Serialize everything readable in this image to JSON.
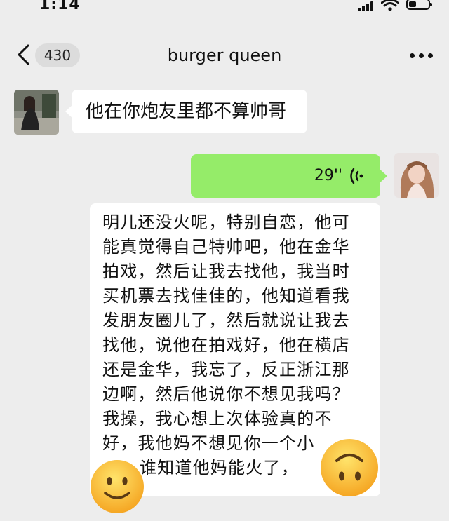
{
  "status_bar": {
    "time": "1:14"
  },
  "nav": {
    "back_icon": "chevron-left-icon",
    "unread_count": "430",
    "title": "burger queen",
    "more_icon": "more-dots-icon"
  },
  "messages": [
    {
      "side": "left",
      "type": "text",
      "text": "他在你炮友里都不算帅哥"
    },
    {
      "side": "right",
      "type": "voice",
      "duration": "29''",
      "icon": "voice-wave-icon"
    },
    {
      "side": "left",
      "type": "text",
      "text": "明儿还没火呢，特别自恋，他可\n能真觉得自己特帅吧，他在金华\n拍戏，然后让我去找他，我当时\n买机票去找佳佳的，他知道看我\n发朋友圈儿了，然后就说让我去\n找他，说他在拍戏好，他在横店\n还是金华，我忘了，反正浙江那\n边啊，然后他说你不想见我吗？\n我操，我心想上次体验真的不\n好，我他妈不想见你一个小\n      谁知道他妈能火了，"
    }
  ],
  "overlays": [
    "smiling-face-emoji",
    "upside-down-face-emoji"
  ],
  "colors": {
    "background": "#ededed",
    "sent_bubble": "#95ec69",
    "received_bubble": "#ffffff"
  }
}
